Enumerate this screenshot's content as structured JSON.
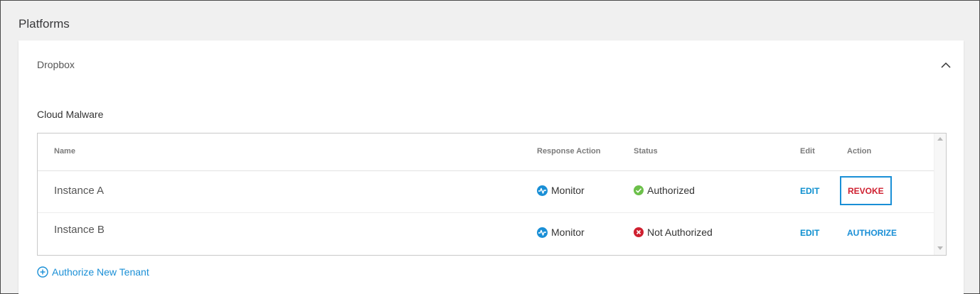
{
  "page": {
    "title": "Platforms"
  },
  "platform_card": {
    "title": "Dropbox",
    "section_title": "Cloud Malware",
    "collapse_icon": "chevron-up-icon"
  },
  "table": {
    "columns": [
      "Name",
      "Response Action",
      "Status",
      "Edit",
      "Action"
    ],
    "rows": [
      {
        "name": "Instance A",
        "response_action": "Monitor",
        "response_icon": "monitor-icon",
        "status": "Authorized",
        "status_icon": "check-circle-icon",
        "status_color": "#6cc04a",
        "edit": "EDIT",
        "action": "REVOKE",
        "action_color": "#cf2030"
      },
      {
        "name": "Instance B",
        "response_action": "Monitor",
        "response_icon": "monitor-icon",
        "status": "Not Authorized",
        "status_icon": "x-circle-icon",
        "status_color": "#cf2030",
        "edit": "EDIT",
        "action": "AUTHORIZE",
        "action_color": "#1a8fd6"
      }
    ]
  },
  "add_tenant": {
    "label": "Authorize New Tenant",
    "icon": "plus-circle-icon"
  },
  "colors": {
    "link": "#1a8fd6",
    "accent_border": "#1a8fd6"
  }
}
